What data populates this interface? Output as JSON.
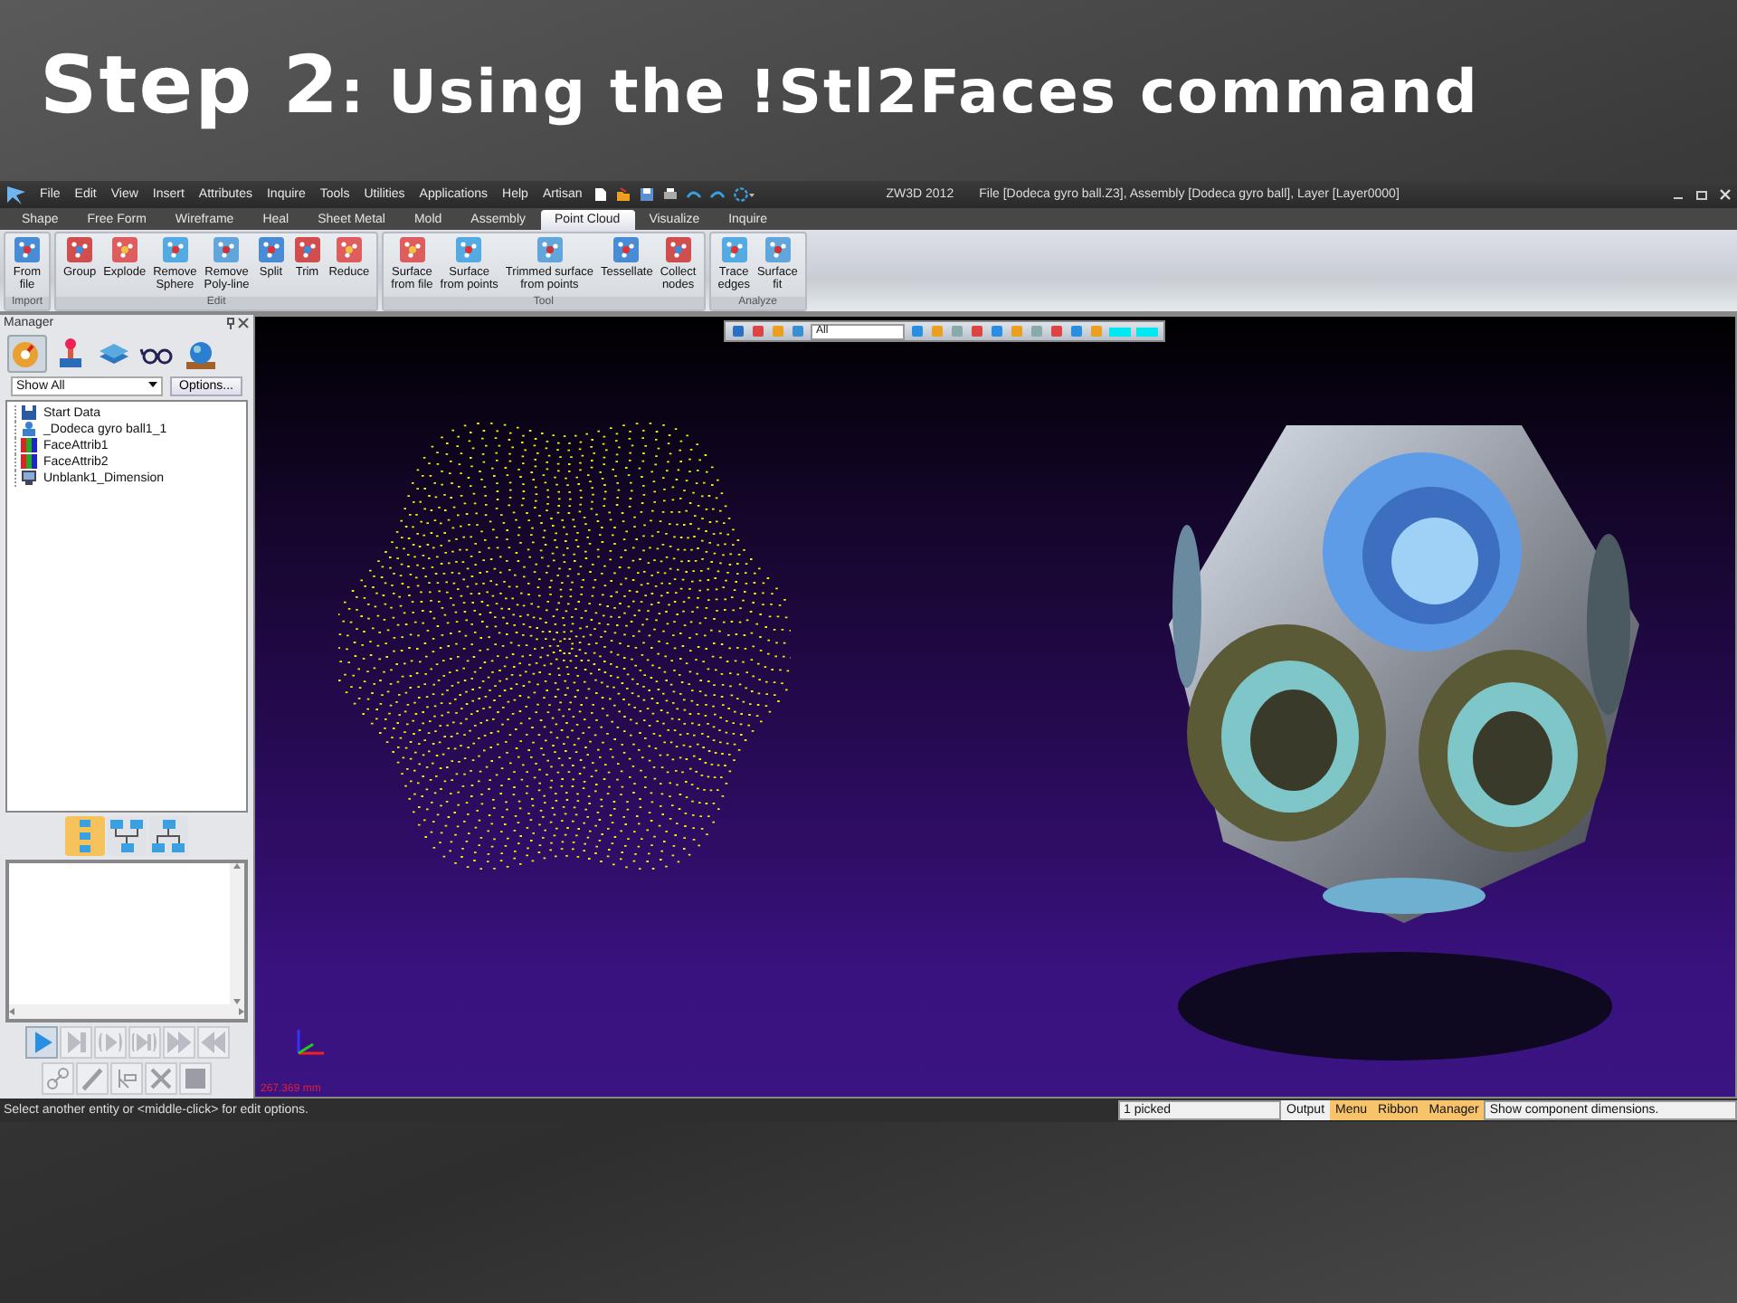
{
  "slide_title": {
    "lead": "Step 2",
    "rest": ": Using the !Stl2Faces command"
  },
  "window": {
    "app": "ZW3D 2012",
    "title": "File [Dodeca gyro ball.Z3],  Assembly [Dodeca gyro ball],  Layer [Layer0000]"
  },
  "menu": [
    "File",
    "Edit",
    "View",
    "Insert",
    "Attributes",
    "Inquire",
    "Tools",
    "Utilities",
    "Applications",
    "Help",
    "Artisan"
  ],
  "ribbon": {
    "tabs": [
      {
        "label": "Shape",
        "selected": false
      },
      {
        "label": "Free Form",
        "selected": false
      },
      {
        "label": "Wireframe",
        "selected": false
      },
      {
        "label": "Heal",
        "selected": false
      },
      {
        "label": "Sheet Metal",
        "selected": false
      },
      {
        "label": "Mold",
        "selected": false
      },
      {
        "label": "Assembly",
        "selected": false
      },
      {
        "label": "Point Cloud",
        "selected": true
      },
      {
        "label": "Visualize",
        "selected": false
      },
      {
        "label": "Inquire",
        "selected": false
      }
    ],
    "groups": [
      {
        "label": "Import",
        "buttons": [
          "From\nfile"
        ]
      },
      {
        "label": "Edit",
        "buttons": [
          "Group",
          "Explode",
          "Remove\nSphere",
          "Remove\nPoly-line",
          "Split",
          "Trim",
          "Reduce"
        ]
      },
      {
        "label": "Tool",
        "buttons": [
          "Surface\nfrom file",
          "Surface\nfrom points",
          "Trimmed surface\nfrom points",
          "Tessellate",
          "Collect\nnodes"
        ]
      },
      {
        "label": "Analyze",
        "buttons": [
          "Trace\nedges",
          "Surface\nfit"
        ]
      }
    ]
  },
  "manager": {
    "title": "Manager",
    "icon_tabs": [
      {
        "selected": true
      },
      {
        "selected": false
      },
      {
        "selected": false
      },
      {
        "selected": false
      },
      {
        "selected": false
      }
    ],
    "filter": {
      "value": "Show All"
    },
    "options_button": "Options...",
    "tree": [
      {
        "label": "Start Data",
        "kind": "save"
      },
      {
        "label": "_Dodeca gyro ball1_1",
        "kind": "part"
      },
      {
        "label": "FaceAttrib1",
        "kind": "attrib"
      },
      {
        "label": "FaceAttrib2",
        "kind": "attrib"
      },
      {
        "label": "Unblank1_Dimension",
        "kind": "dimension"
      }
    ],
    "views": [
      {
        "selected": true
      },
      {
        "selected": false
      },
      {
        "selected": false
      }
    ],
    "playback": [
      {
        "disabled": false
      },
      {
        "disabled": true
      },
      {
        "disabled": true
      },
      {
        "disabled": true
      },
      {
        "disabled": true
      },
      {
        "disabled": true
      }
    ],
    "tools": [
      {
        "disabled": true
      },
      {
        "disabled": true
      },
      {
        "disabled": true
      },
      {
        "disabled": true
      },
      {
        "disabled": true
      }
    ]
  },
  "viewport": {
    "filter": {
      "value": "All"
    },
    "measure": "267.369 mm"
  },
  "status_bar": {
    "prompt": "Select another entity or <middle-click> for edit options.",
    "picked": "1 picked",
    "output": "Output",
    "tabs": [
      "Menu",
      "Ribbon",
      "Manager"
    ],
    "message": "Show component dimensions."
  }
}
